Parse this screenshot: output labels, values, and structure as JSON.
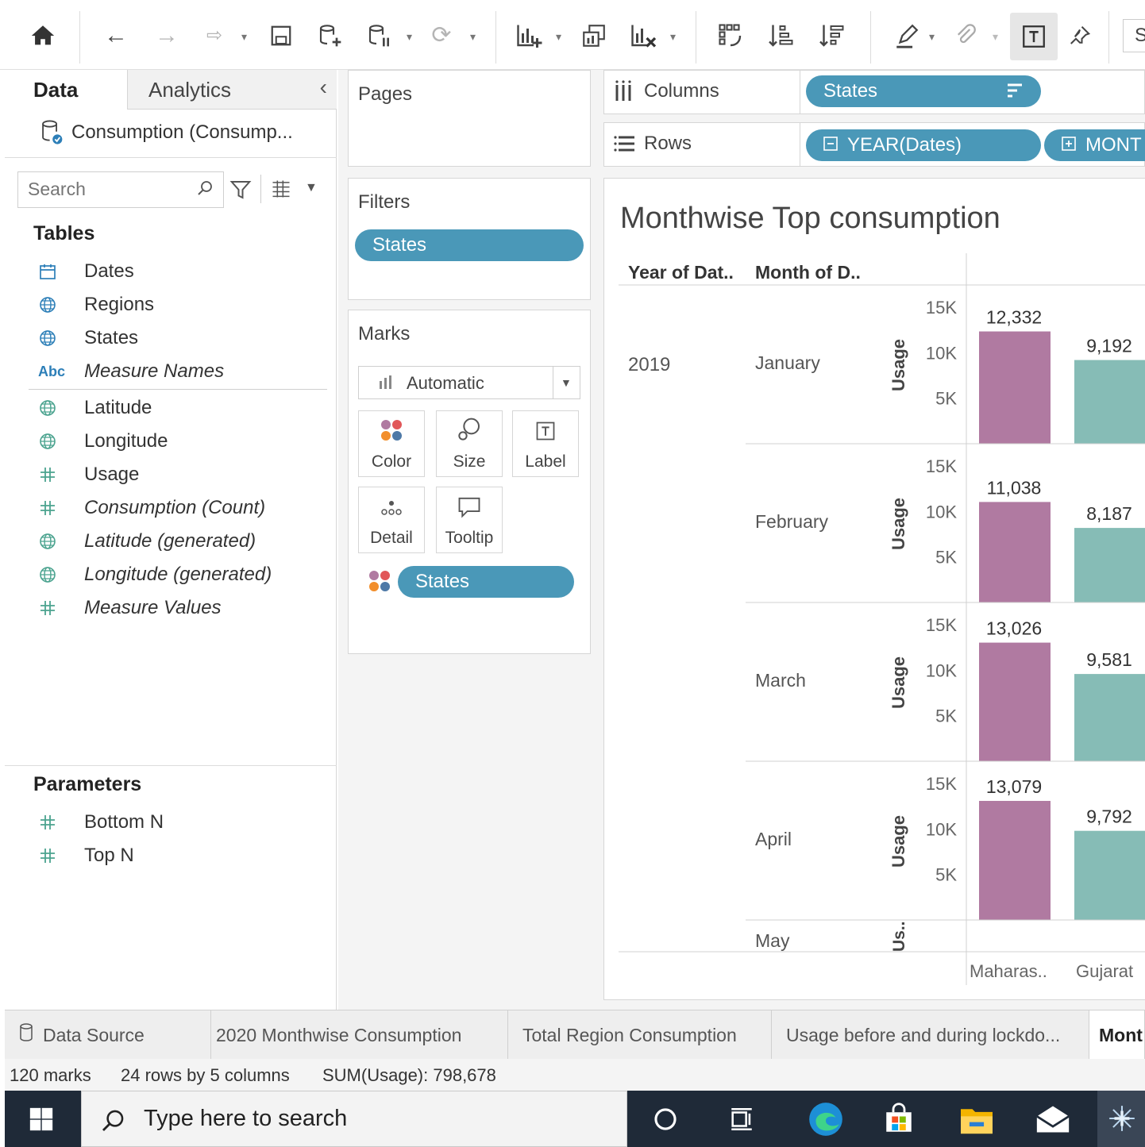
{
  "leftpane": {
    "tab_data": "Data",
    "tab_analytics": "Analytics",
    "datasource": "Consumption (Consump...",
    "search_placeholder": "Search",
    "tables_heading": "Tables",
    "fields": [
      {
        "label": "Dates",
        "icon": "calendar-icon",
        "italic": false
      },
      {
        "label": "Regions",
        "icon": "globe-icon",
        "italic": false
      },
      {
        "label": "States",
        "icon": "globe-icon",
        "italic": false
      },
      {
        "label": "Measure Names",
        "icon": "abc-icon",
        "italic": true
      },
      {
        "label": "Latitude",
        "icon": "globe-icon",
        "italic": false
      },
      {
        "label": "Longitude",
        "icon": "globe-icon",
        "italic": false
      },
      {
        "label": "Usage",
        "icon": "hash-icon",
        "italic": false
      },
      {
        "label": "Consumption (Count)",
        "icon": "hash-icon",
        "italic": true
      },
      {
        "label": "Latitude (generated)",
        "icon": "globe-icon",
        "italic": true
      },
      {
        "label": "Longitude (generated)",
        "icon": "globe-icon",
        "italic": true
      },
      {
        "label": "Measure Values",
        "icon": "hash-icon",
        "italic": true
      }
    ],
    "parameters_heading": "Parameters",
    "parameters": [
      {
        "label": "Bottom N"
      },
      {
        "label": "Top N"
      }
    ]
  },
  "middle": {
    "pages_title": "Pages",
    "filters_title": "Filters",
    "filter_pill": "States",
    "marks_title": "Marks",
    "mark_type": "Automatic",
    "mark_buttons": [
      "Color",
      "Size",
      "Label",
      "Detail",
      "Tooltip"
    ],
    "marks_pill": "States"
  },
  "shelves": {
    "columns_label": "Columns",
    "columns_pill": "States",
    "rows_label": "Rows",
    "rows_pill_1": "YEAR(Dates)",
    "rows_pill_2": "MONT"
  },
  "viz": {
    "title": "Monthwise Top consumption",
    "header_year": "Year of Dat..",
    "header_month": "Month of D..",
    "year": "2019",
    "axis_label": "Usage",
    "axis_label_short": "Us..",
    "footer_categories": [
      "Maharas..",
      "Gujarat"
    ]
  },
  "chart_data": {
    "type": "bar",
    "title": "Monthwise Top consumption",
    "ylabel": "Usage",
    "ylim": [
      0,
      17000
    ],
    "yticks": [
      "5K",
      "10K",
      "15K"
    ],
    "categories": [
      "Maharas..",
      "Gujarat"
    ],
    "colors": [
      "#b07aa1",
      "#86bcb6"
    ],
    "rows": [
      {
        "month": "January",
        "values": [
          12332,
          9192
        ],
        "labels": [
          "12,332",
          "9,192"
        ]
      },
      {
        "month": "February",
        "values": [
          11038,
          8187
        ],
        "labels": [
          "11,038",
          "8,187"
        ]
      },
      {
        "month": "March",
        "values": [
          13026,
          9581
        ],
        "labels": [
          "13,026",
          "9,581"
        ]
      },
      {
        "month": "April",
        "values": [
          13079,
          9792
        ],
        "labels": [
          "13,079",
          "9,792"
        ]
      }
    ],
    "partial_row": "May"
  },
  "sheets": {
    "data_source": "Data Source",
    "tabs": [
      "2020 Monthwise Consumption",
      "Total Region Consumption",
      "Usage before and during lockdo...",
      "Mont"
    ]
  },
  "status": {
    "marks": "120 marks",
    "rows_cols": "24 rows by 5 columns",
    "sum": "SUM(Usage): 798,678"
  },
  "taskbar": {
    "search_placeholder": "Type here to search"
  },
  "toolbar": {
    "search_stub": "S"
  }
}
